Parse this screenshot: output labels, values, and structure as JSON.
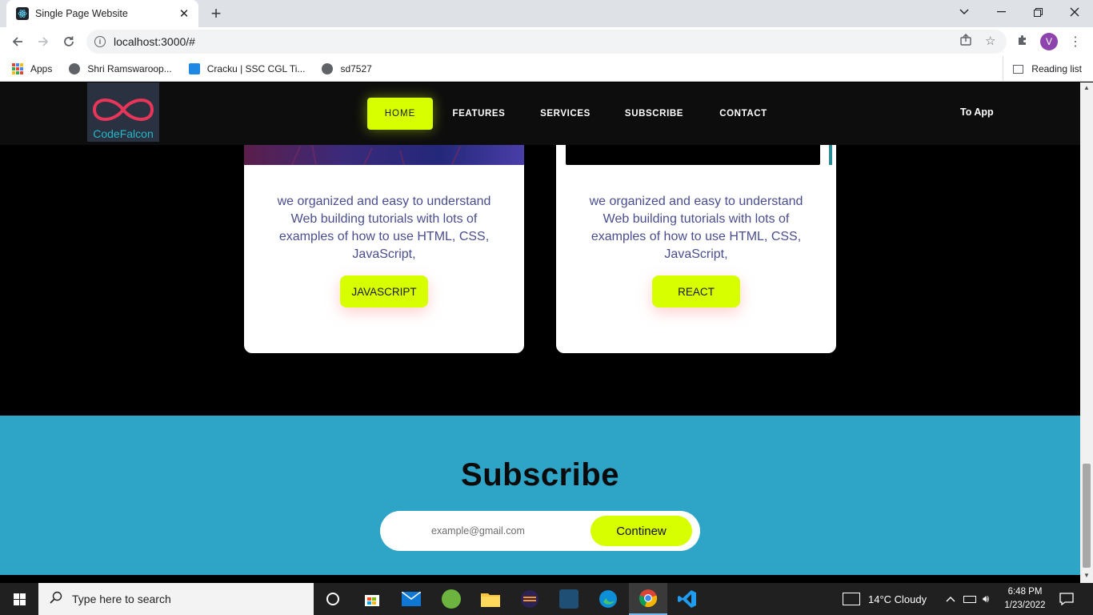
{
  "browser": {
    "tab_title": "Single Page Website",
    "url": "localhost:3000/#",
    "profile_initial": "V",
    "bookmarks": [
      "Apps",
      "Shri Ramswaroop...",
      "Cracku | SSC CGL Ti...",
      "sd7527"
    ],
    "reading_list": "Reading list"
  },
  "site": {
    "logo_text": "CodeFalcon",
    "nav": [
      "HOME",
      "FEATURES",
      "SERVICES",
      "SUBSCRIBE",
      "CONTACT"
    ],
    "to_app": "To App",
    "accent_color": "#d7ff00",
    "cards": [
      {
        "text": "we organized and easy to understand Web building tutorials with lots of examples of how to use HTML, CSS, JavaScript,",
        "button": "JAVASCRIPT"
      },
      {
        "text": "we organized and easy to understand Web building tutorials with lots of examples of how to use HTML, CSS, JavaScript,",
        "button": "REACT"
      }
    ],
    "subscribe": {
      "title": "Subscribe",
      "placeholder": "example@gmail.com",
      "button": "Continew"
    }
  },
  "taskbar": {
    "search_placeholder": "Type here to search",
    "weather": "14°C  Cloudy",
    "time": "6:48 PM",
    "date": "1/23/2022"
  }
}
